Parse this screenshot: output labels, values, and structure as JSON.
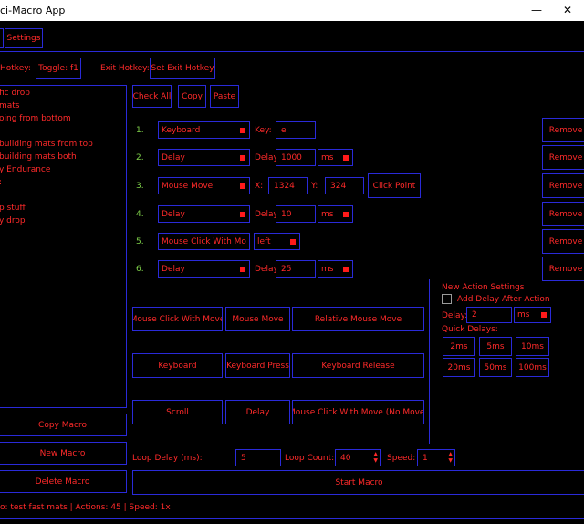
{
  "window": {
    "title": "ci-Macro App",
    "minimize": "—",
    "close": "✕"
  },
  "tabs": {
    "settings": "Settings"
  },
  "hotkeys": {
    "hotkey_label": "Hotkey:",
    "toggle": "Toggle: f1",
    "exit_label": "Exit Hotkey:",
    "set_exit": "Set Exit Hotkey"
  },
  "macro_list": [
    "fic drop",
    "mats",
    "oing from bottom",
    "",
    "building mats from top",
    "building mats both",
    "y Endurance",
    ":",
    "",
    "p stuff",
    "y drop"
  ],
  "left_buttons": {
    "copy": "Copy Macro",
    "new": "New Macro",
    "delete": "Delete Macro"
  },
  "editor_toolbar": {
    "check_all": "Check All",
    "copy": "Copy",
    "paste": "Paste"
  },
  "actions": [
    {
      "num": "1.",
      "type": "Keyboard",
      "l1": "Key:",
      "v1": "e"
    },
    {
      "num": "2.",
      "type": "Delay",
      "l1": "Delay",
      "v1": "1000",
      "unit": "ms"
    },
    {
      "num": "3.",
      "type": "Mouse Move",
      "l1": "X:",
      "v1": "1324",
      "l2": "Y:",
      "v2": "324",
      "extra": "Click Point"
    },
    {
      "num": "4.",
      "type": "Delay",
      "l1": "Delay",
      "v1": "10",
      "unit": "ms"
    },
    {
      "num": "5.",
      "type": "Mouse Click With Mo",
      "v1": "left"
    },
    {
      "num": "6.",
      "type": "Delay",
      "l1": "Delay",
      "v1": "25",
      "unit": "ms"
    }
  ],
  "remove_label": "Remove",
  "add_buttons": {
    "row1": [
      "Mouse Click With Move",
      "Mouse Move",
      "Relative Mouse Move"
    ],
    "row2": [
      "Keyboard",
      "Keyboard Press",
      "Keyboard Release"
    ],
    "row3": [
      "Scroll",
      "Delay",
      "Mouse Click With Move (No Move)"
    ]
  },
  "new_action": {
    "title": "New Action Settings",
    "add_delay": "Add Delay After Action",
    "delay_label": "Delay:",
    "delay_value": "2",
    "delay_unit": "ms",
    "quick_label": "Quick Delays:",
    "quick": [
      "2ms",
      "5ms",
      "10ms",
      "20ms",
      "50ms",
      "100ms"
    ]
  },
  "loop": {
    "delay_label": "Loop Delay (ms):",
    "delay_value": "5",
    "count_label": "Loop Count:",
    "count_value": "40",
    "speed_label": "Speed:",
    "speed_value": "1"
  },
  "start": "Start Macro",
  "status": "o: test fast mats | Actions: 45 | Speed: 1x",
  "colors": {
    "accent_text": "#ff2a2a",
    "border": "#2a2ad8",
    "index": "#7fd14a",
    "background": "#000000"
  }
}
